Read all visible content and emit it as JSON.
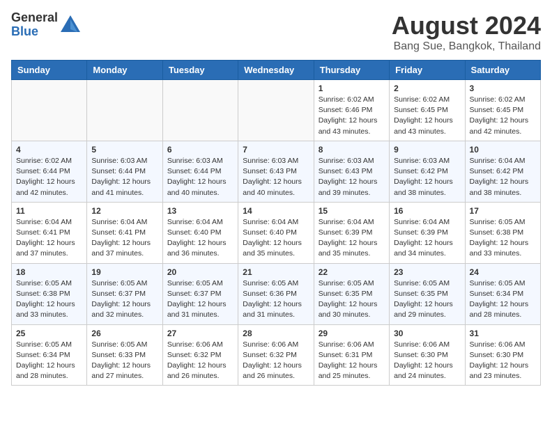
{
  "header": {
    "logo_general": "General",
    "logo_blue": "Blue",
    "main_title": "August 2024",
    "subtitle": "Bang Sue, Bangkok, Thailand"
  },
  "weekdays": [
    "Sunday",
    "Monday",
    "Tuesday",
    "Wednesday",
    "Thursday",
    "Friday",
    "Saturday"
  ],
  "weeks": [
    {
      "rowClass": "row-odd",
      "days": [
        {
          "num": "",
          "info": "",
          "empty": true
        },
        {
          "num": "",
          "info": "",
          "empty": true
        },
        {
          "num": "",
          "info": "",
          "empty": true
        },
        {
          "num": "",
          "info": "",
          "empty": true
        },
        {
          "num": "1",
          "info": "Sunrise: 6:02 AM\nSunset: 6:46 PM\nDaylight: 12 hours\nand 43 minutes.",
          "empty": false
        },
        {
          "num": "2",
          "info": "Sunrise: 6:02 AM\nSunset: 6:45 PM\nDaylight: 12 hours\nand 43 minutes.",
          "empty": false
        },
        {
          "num": "3",
          "info": "Sunrise: 6:02 AM\nSunset: 6:45 PM\nDaylight: 12 hours\nand 42 minutes.",
          "empty": false
        }
      ]
    },
    {
      "rowClass": "row-even",
      "days": [
        {
          "num": "4",
          "info": "Sunrise: 6:02 AM\nSunset: 6:44 PM\nDaylight: 12 hours\nand 42 minutes.",
          "empty": false
        },
        {
          "num": "5",
          "info": "Sunrise: 6:03 AM\nSunset: 6:44 PM\nDaylight: 12 hours\nand 41 minutes.",
          "empty": false
        },
        {
          "num": "6",
          "info": "Sunrise: 6:03 AM\nSunset: 6:44 PM\nDaylight: 12 hours\nand 40 minutes.",
          "empty": false
        },
        {
          "num": "7",
          "info": "Sunrise: 6:03 AM\nSunset: 6:43 PM\nDaylight: 12 hours\nand 40 minutes.",
          "empty": false
        },
        {
          "num": "8",
          "info": "Sunrise: 6:03 AM\nSunset: 6:43 PM\nDaylight: 12 hours\nand 39 minutes.",
          "empty": false
        },
        {
          "num": "9",
          "info": "Sunrise: 6:03 AM\nSunset: 6:42 PM\nDaylight: 12 hours\nand 38 minutes.",
          "empty": false
        },
        {
          "num": "10",
          "info": "Sunrise: 6:04 AM\nSunset: 6:42 PM\nDaylight: 12 hours\nand 38 minutes.",
          "empty": false
        }
      ]
    },
    {
      "rowClass": "row-odd",
      "days": [
        {
          "num": "11",
          "info": "Sunrise: 6:04 AM\nSunset: 6:41 PM\nDaylight: 12 hours\nand 37 minutes.",
          "empty": false
        },
        {
          "num": "12",
          "info": "Sunrise: 6:04 AM\nSunset: 6:41 PM\nDaylight: 12 hours\nand 37 minutes.",
          "empty": false
        },
        {
          "num": "13",
          "info": "Sunrise: 6:04 AM\nSunset: 6:40 PM\nDaylight: 12 hours\nand 36 minutes.",
          "empty": false
        },
        {
          "num": "14",
          "info": "Sunrise: 6:04 AM\nSunset: 6:40 PM\nDaylight: 12 hours\nand 35 minutes.",
          "empty": false
        },
        {
          "num": "15",
          "info": "Sunrise: 6:04 AM\nSunset: 6:39 PM\nDaylight: 12 hours\nand 35 minutes.",
          "empty": false
        },
        {
          "num": "16",
          "info": "Sunrise: 6:04 AM\nSunset: 6:39 PM\nDaylight: 12 hours\nand 34 minutes.",
          "empty": false
        },
        {
          "num": "17",
          "info": "Sunrise: 6:05 AM\nSunset: 6:38 PM\nDaylight: 12 hours\nand 33 minutes.",
          "empty": false
        }
      ]
    },
    {
      "rowClass": "row-even",
      "days": [
        {
          "num": "18",
          "info": "Sunrise: 6:05 AM\nSunset: 6:38 PM\nDaylight: 12 hours\nand 33 minutes.",
          "empty": false
        },
        {
          "num": "19",
          "info": "Sunrise: 6:05 AM\nSunset: 6:37 PM\nDaylight: 12 hours\nand 32 minutes.",
          "empty": false
        },
        {
          "num": "20",
          "info": "Sunrise: 6:05 AM\nSunset: 6:37 PM\nDaylight: 12 hours\nand 31 minutes.",
          "empty": false
        },
        {
          "num": "21",
          "info": "Sunrise: 6:05 AM\nSunset: 6:36 PM\nDaylight: 12 hours\nand 31 minutes.",
          "empty": false
        },
        {
          "num": "22",
          "info": "Sunrise: 6:05 AM\nSunset: 6:35 PM\nDaylight: 12 hours\nand 30 minutes.",
          "empty": false
        },
        {
          "num": "23",
          "info": "Sunrise: 6:05 AM\nSunset: 6:35 PM\nDaylight: 12 hours\nand 29 minutes.",
          "empty": false
        },
        {
          "num": "24",
          "info": "Sunrise: 6:05 AM\nSunset: 6:34 PM\nDaylight: 12 hours\nand 28 minutes.",
          "empty": false
        }
      ]
    },
    {
      "rowClass": "row-odd",
      "days": [
        {
          "num": "25",
          "info": "Sunrise: 6:05 AM\nSunset: 6:34 PM\nDaylight: 12 hours\nand 28 minutes.",
          "empty": false
        },
        {
          "num": "26",
          "info": "Sunrise: 6:05 AM\nSunset: 6:33 PM\nDaylight: 12 hours\nand 27 minutes.",
          "empty": false
        },
        {
          "num": "27",
          "info": "Sunrise: 6:06 AM\nSunset: 6:32 PM\nDaylight: 12 hours\nand 26 minutes.",
          "empty": false
        },
        {
          "num": "28",
          "info": "Sunrise: 6:06 AM\nSunset: 6:32 PM\nDaylight: 12 hours\nand 26 minutes.",
          "empty": false
        },
        {
          "num": "29",
          "info": "Sunrise: 6:06 AM\nSunset: 6:31 PM\nDaylight: 12 hours\nand 25 minutes.",
          "empty": false
        },
        {
          "num": "30",
          "info": "Sunrise: 6:06 AM\nSunset: 6:30 PM\nDaylight: 12 hours\nand 24 minutes.",
          "empty": false
        },
        {
          "num": "31",
          "info": "Sunrise: 6:06 AM\nSunset: 6:30 PM\nDaylight: 12 hours\nand 23 minutes.",
          "empty": false
        }
      ]
    }
  ]
}
